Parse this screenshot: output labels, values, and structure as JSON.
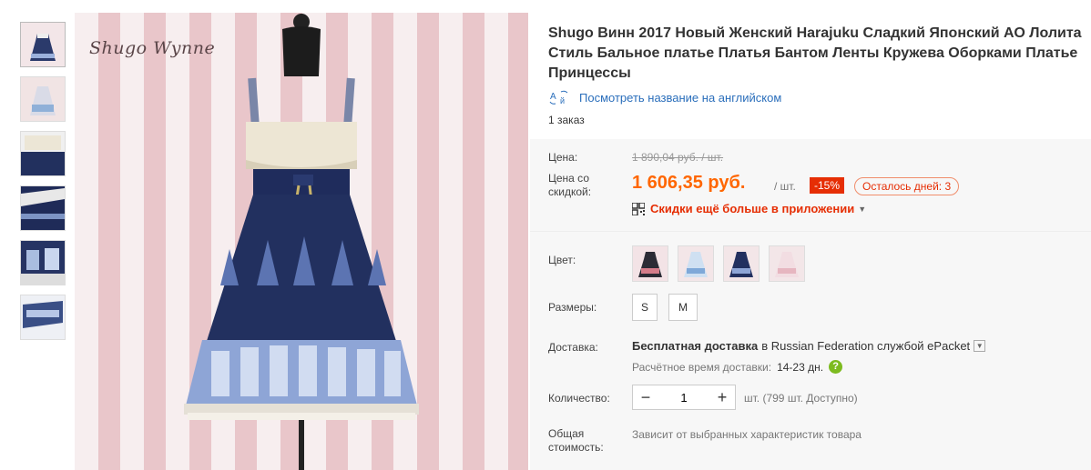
{
  "product": {
    "title": "Shugo Винн 2017 Новый Женский Harajuku Сладкий Японский АО Лолита Стиль Бальное платье Платья Бантом Ленты Кружева Оборками Платье Принцессы",
    "translate_link": "Посмотреть название на английском",
    "orders": "1 заказ",
    "logo_text": "Shugo Wynne"
  },
  "price": {
    "label": "Цена:",
    "original": "1 890,04 руб. / шт.",
    "discount_label": "Цена со скидкой:",
    "discounted": "1 606,35 руб.",
    "unit": "/ шт.",
    "discount_badge": "-15%",
    "days_left": "Осталось дней: 3",
    "app_promo": "Скидки ещё больше в приложении"
  },
  "options": {
    "color_label": "Цвет:",
    "sizes_label": "Размеры:",
    "sizes": [
      "S",
      "M"
    ],
    "delivery_label": "Доставка:",
    "delivery_free": "Бесплатная доставка",
    "delivery_rest": "в Russian Federation службой ePacket",
    "delivery_time_label": "Расчётное время доставки:",
    "delivery_time_value": "14-23 дн.",
    "quantity_label": "Количество:",
    "quantity_value": "1",
    "quantity_available": "шт. (799 шт. Доступно)",
    "total_label": "Общая стоимость:",
    "total_value": "Зависит от выбранных характеристик товара"
  },
  "colors": {
    "accent": "#ff6600",
    "discount": "#e62e04",
    "link": "#2a6ebb",
    "panel": "#f7f7f7"
  }
}
